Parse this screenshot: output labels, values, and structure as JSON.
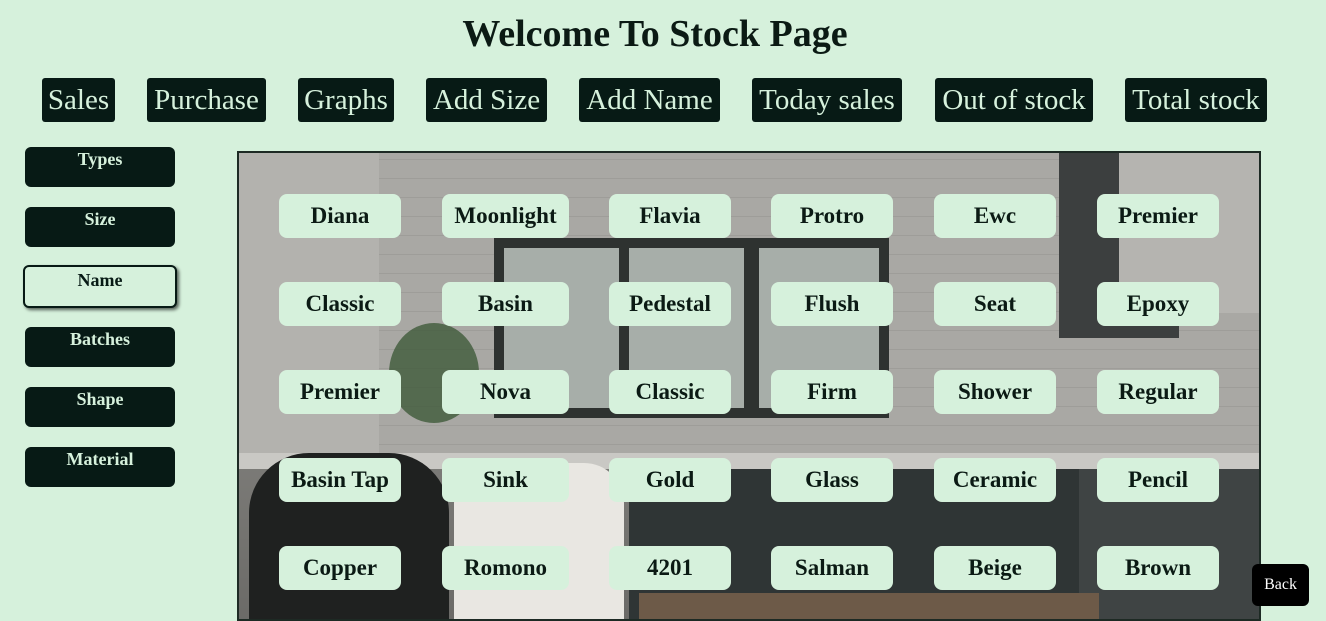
{
  "page": {
    "title": "Welcome To Stock Page"
  },
  "topnav": [
    "Sales",
    "Purchase",
    "Graphs",
    "Add Size",
    "Add Name",
    "Today sales",
    "Out of stock",
    "Total stock"
  ],
  "sidebar": [
    "Types",
    "Size",
    "Name",
    "Batches",
    "Shape",
    "Material"
  ],
  "sidebar_active": "Name",
  "names": [
    [
      "Diana",
      "Moonlight",
      "Flavia",
      "Protro",
      "Ewc",
      "Premier"
    ],
    [
      "Classic",
      "Basin",
      "Pedestal",
      "Flush",
      "Seat",
      "Epoxy"
    ],
    [
      "Premier",
      "Nova",
      "Classic",
      "Firm",
      "Shower",
      "Regular"
    ],
    [
      "Basin Tap",
      "Sink",
      "Gold",
      "Glass",
      "Ceramic",
      "Pencil"
    ],
    [
      "Copper",
      "Romono",
      "4201",
      "Salman",
      "Beige",
      "Brown"
    ]
  ],
  "back_label": "Back",
  "colors": {
    "background": "#d6f1dc",
    "button": "#071a15",
    "chip": "#d6f1dc"
  }
}
